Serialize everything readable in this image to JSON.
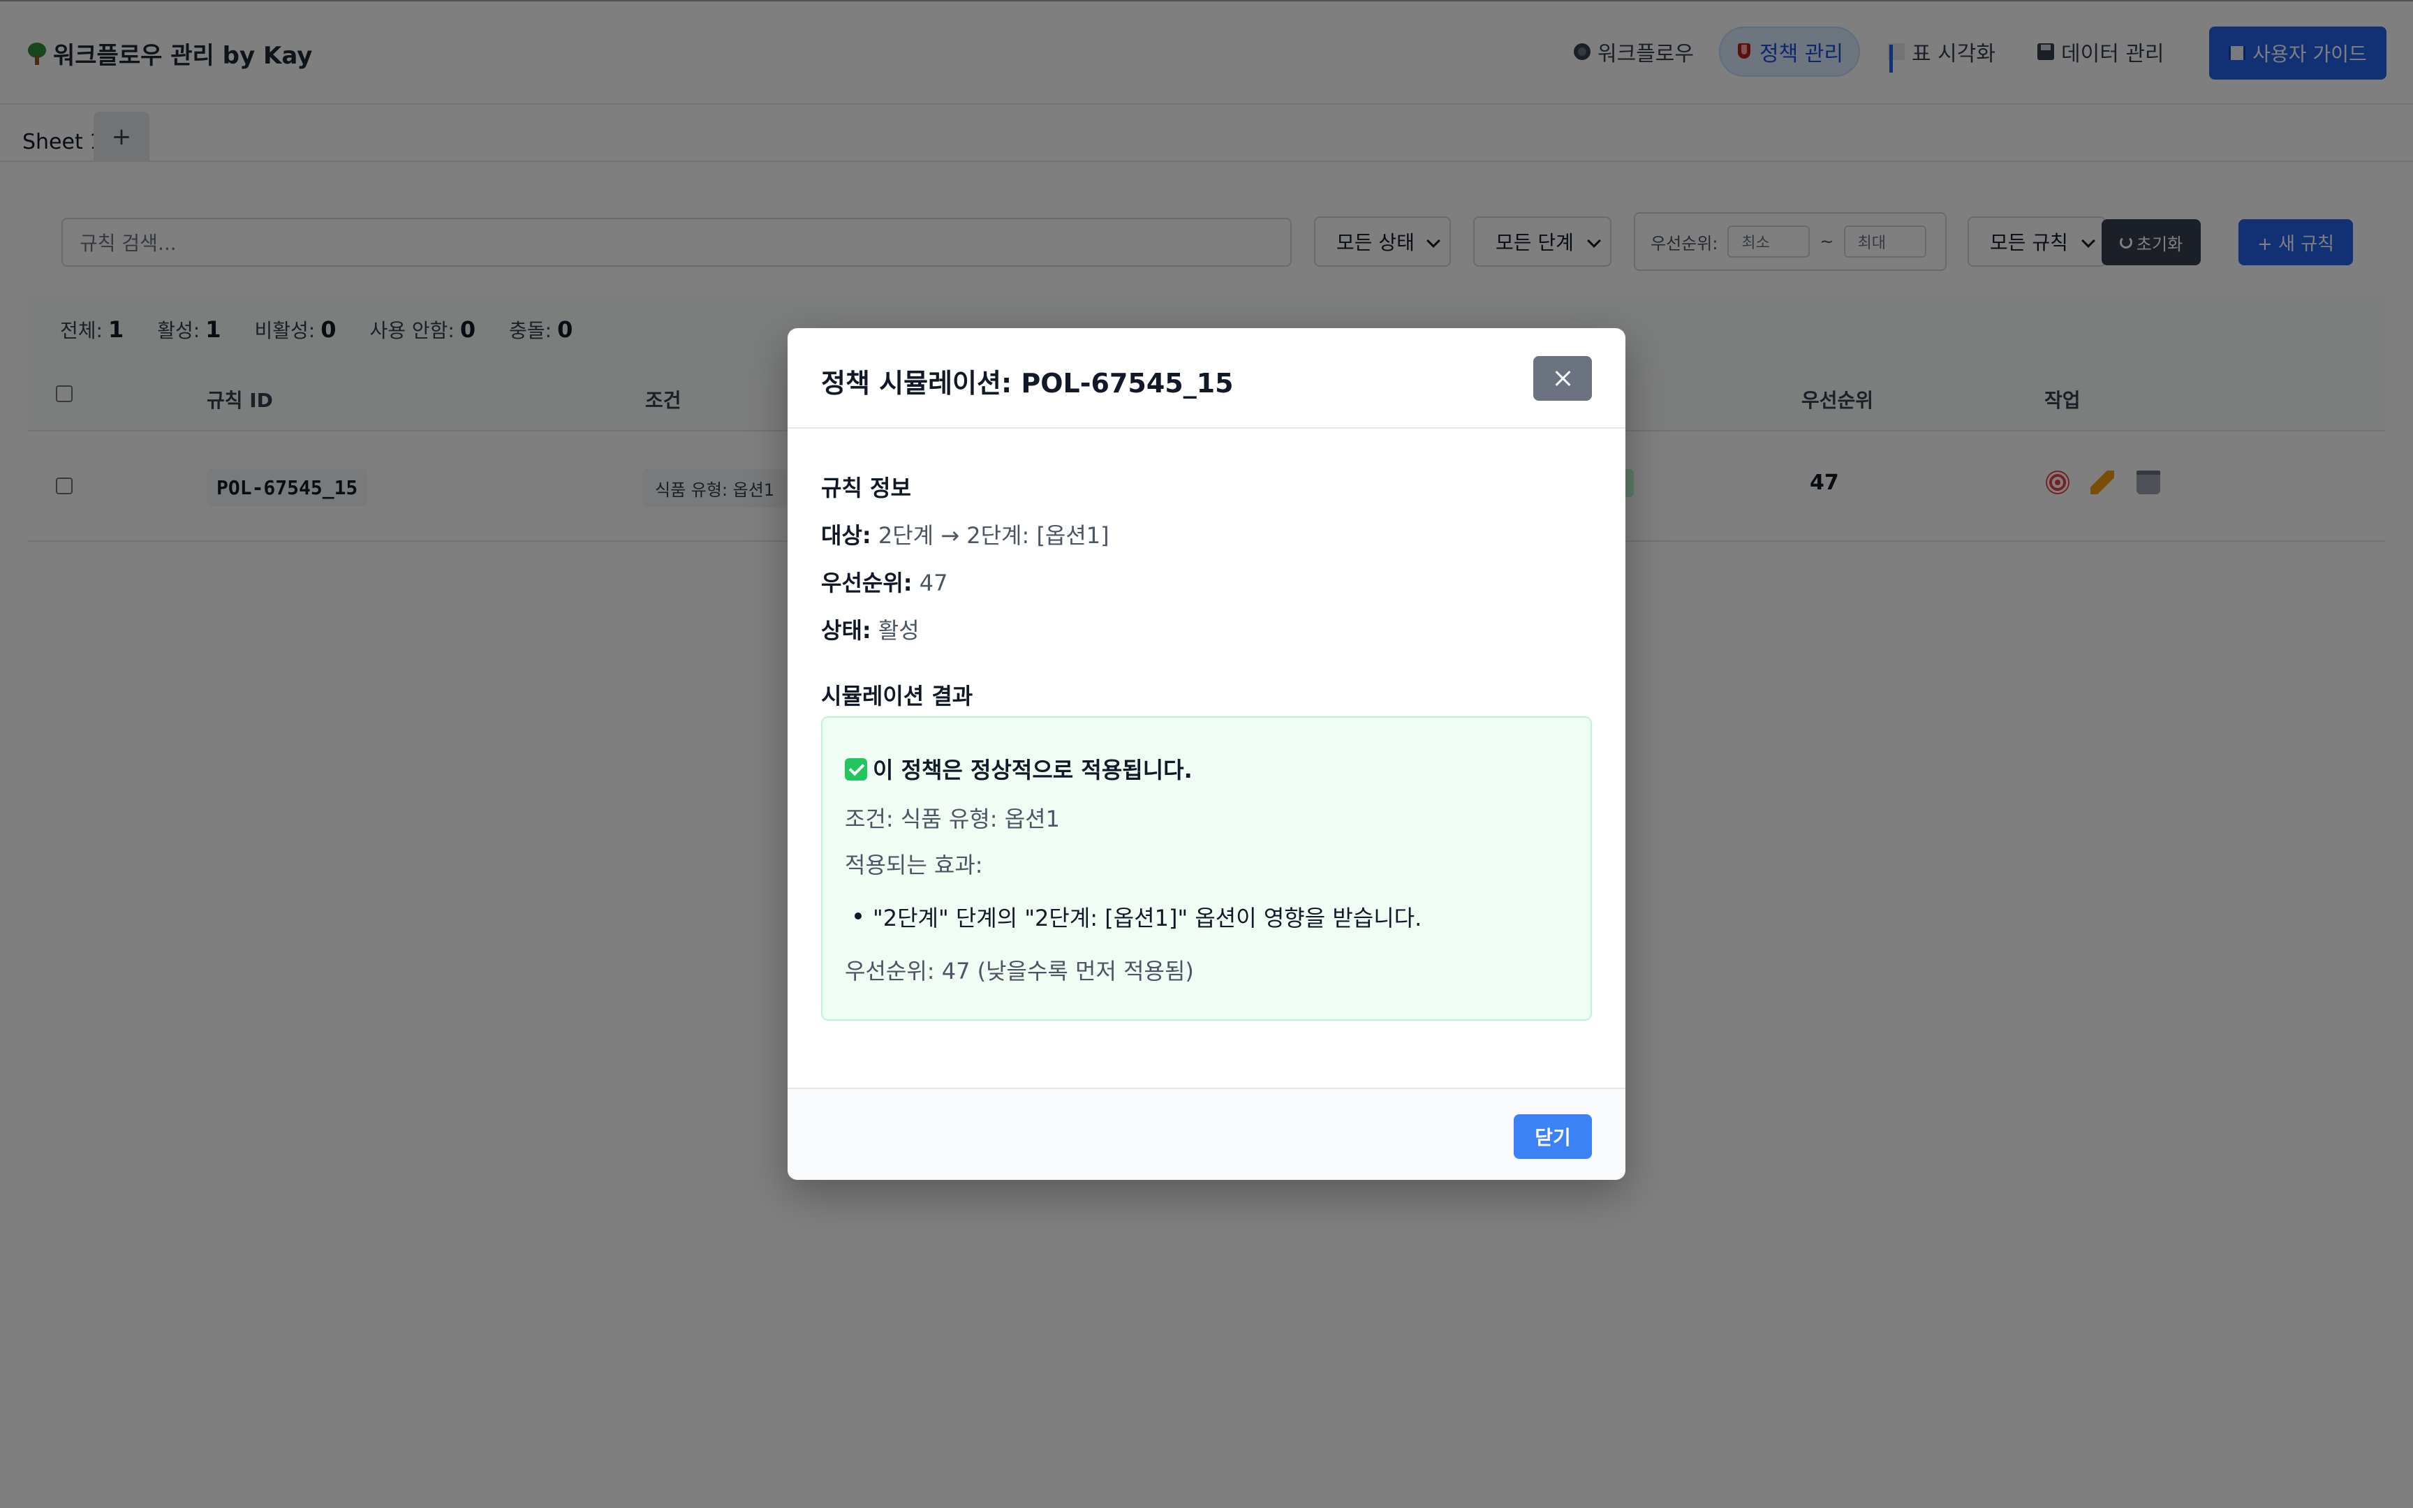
{
  "app": {
    "title": "워크플로우 관리 by Kay"
  },
  "nav": {
    "workflow": "워크플로우",
    "policy": "정책 관리",
    "visualize": "표 시각화",
    "data": "데이터 관리",
    "guide": "사용자 가이드"
  },
  "sheets": {
    "tab1": "Sheet 1",
    "add": "+"
  },
  "filters": {
    "search_placeholder": "규칙 검색...",
    "status": "모든 상태",
    "stage": "모든 단계",
    "priority_label": "우선순위:",
    "min_placeholder": "최소",
    "tilde": "~",
    "max_placeholder": "최대",
    "rules": "모든 규칙",
    "reset": "초기화",
    "new_rule": "+ 새 규칙"
  },
  "stats": {
    "total_label": "전체:",
    "total": "1",
    "active_label": "활성:",
    "active": "1",
    "inactive_label": "비활성:",
    "inactive": "0",
    "unused_label": "사용 안함:",
    "unused": "0",
    "conflict_label": "충돌:",
    "conflict": "0"
  },
  "table": {
    "headers": {
      "rule_id": "규칙 ID",
      "condition": "조건",
      "priority": "우선순위",
      "actions": "작업"
    },
    "rows": [
      {
        "rule_id": "POL-67545_15",
        "condition": "식품 유형: 옵션1",
        "status": "활성",
        "priority": "47"
      }
    ]
  },
  "modal": {
    "title": "정책 시뮬레이션: POL-67545_15",
    "rule_info_title": "규칙 정보",
    "target_label": "대상:",
    "target_value": "2단계 → 2단계: [옵션1]",
    "priority_label": "우선순위:",
    "priority_value": "47",
    "status_label": "상태:",
    "status_value": "활성",
    "result_title": "시뮬레이션 결과",
    "result_head": "이 정책은 정상적으로 적용됩니다.",
    "result_condition": "조건: 식품 유형: 옵션1",
    "result_effects_label": "적용되는 효과:",
    "result_effect_1": "\"2단계\" 단계의 \"2단계: [옵션1]\" 옵션이 영향을 받습니다.",
    "result_priority": "우선순위: 47 (낮을수록 먼저 적용됨)",
    "close": "닫기"
  },
  "colors": {
    "accent": "#2563eb",
    "success_bg": "#f0fdf4",
    "success_border": "#bbf7d0"
  }
}
